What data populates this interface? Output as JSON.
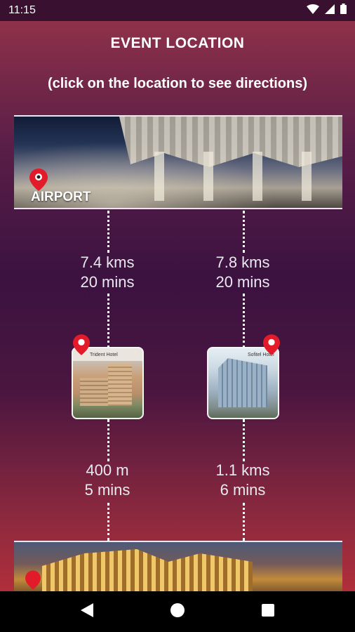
{
  "status_bar": {
    "time": "11:15"
  },
  "header": {
    "title": "EVENT LOCATION",
    "subtitle": "(click on the location to see directions)"
  },
  "origin": {
    "label": "AIRPORT"
  },
  "routes": [
    {
      "from_airport_distance": "7.4 kms",
      "from_airport_time": "20 mins",
      "hotel_caption": "Trident Hotel",
      "to_venue_distance": "400 m",
      "to_venue_time": "5 mins"
    },
    {
      "from_airport_distance": "7.8 kms",
      "from_airport_time": "20 mins",
      "hotel_caption": "Sofitel Hotel",
      "to_venue_distance": "1.1 kms",
      "to_venue_time": "6 mins"
    }
  ],
  "colors": {
    "pin": "#e21b2a",
    "accent_top": "#8e3149",
    "accent_bottom": "#b02e3a"
  },
  "icons": [
    "wifi-icon",
    "signal-icon",
    "battery-icon",
    "location-pin-icon",
    "back-icon",
    "home-icon",
    "recents-icon"
  ]
}
